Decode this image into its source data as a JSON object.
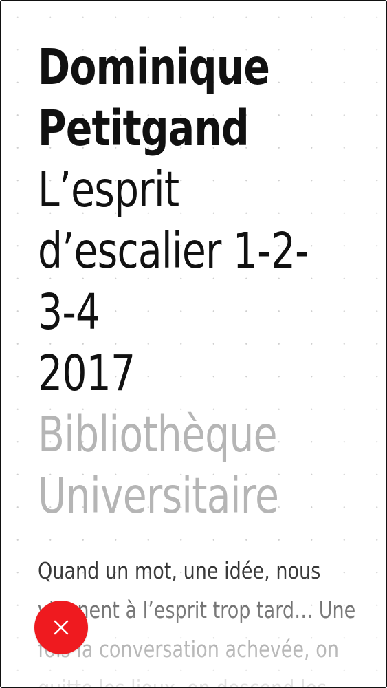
{
  "entry": {
    "artist_lines": [
      "Dominique",
      "Petitgand"
    ],
    "work_lines": [
      "L’esprit",
      "d’escalier 1-2-",
      "3-4"
    ],
    "year": "2017",
    "venue_lines": [
      "Bibliothèque",
      "Universitaire"
    ]
  },
  "description": {
    "lines": [
      "Quand un mot, une idée, nous",
      "viennent à l’esprit trop tard… Une",
      "fois la conversation achevée, on",
      "quitte les lieux, on descend les"
    ]
  },
  "controls": {
    "close_icon": "close-icon",
    "close_color": "#ef1a1f"
  },
  "colors": {
    "text_primary": "#111111",
    "text_muted": "#b5b5b5",
    "accent": "#ef1a1f"
  }
}
